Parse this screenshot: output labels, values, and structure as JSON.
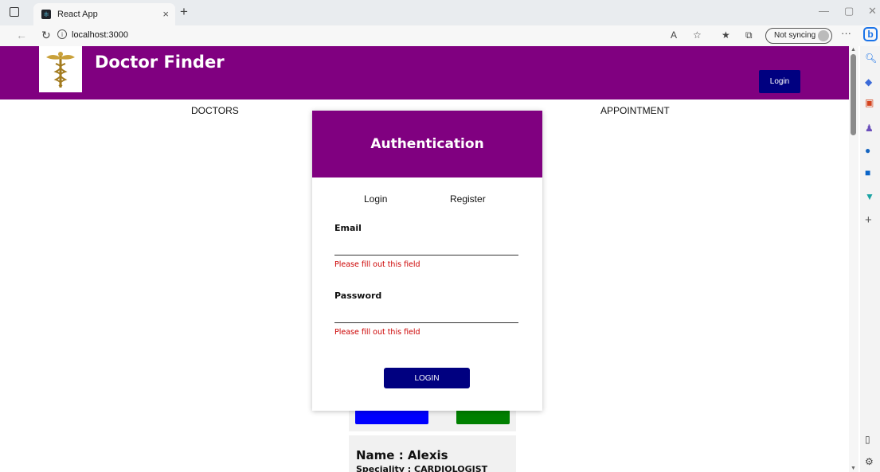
{
  "browser": {
    "tab_title": "React App",
    "tab_close": "×",
    "new_tab": "+",
    "url": "localhost:3000",
    "sync_label": "Not syncing",
    "more_label": "···"
  },
  "header": {
    "brand": "Doctor Finder",
    "login_label": "Login",
    "color": "#800080"
  },
  "nav": {
    "doctors": "DOCTORS",
    "appointment": "APPOINTMENT"
  },
  "modal": {
    "title": "Authentication",
    "tabs": [
      "Login",
      "Register"
    ],
    "email_label": "Email",
    "email_value": "",
    "email_error": "Please fill out this field",
    "password_label": "Password",
    "password_value": "",
    "password_error": "Please fill out this field",
    "submit_label": "LOGIN"
  },
  "doctor_card": {
    "name": "Name : Alexis",
    "speciality": "Speciality : CARDIOLOGIST"
  },
  "colors": {
    "primary": "#800080",
    "button": "#000080",
    "error": "#cc0000",
    "book": "#0000ff",
    "view": "#008000"
  }
}
